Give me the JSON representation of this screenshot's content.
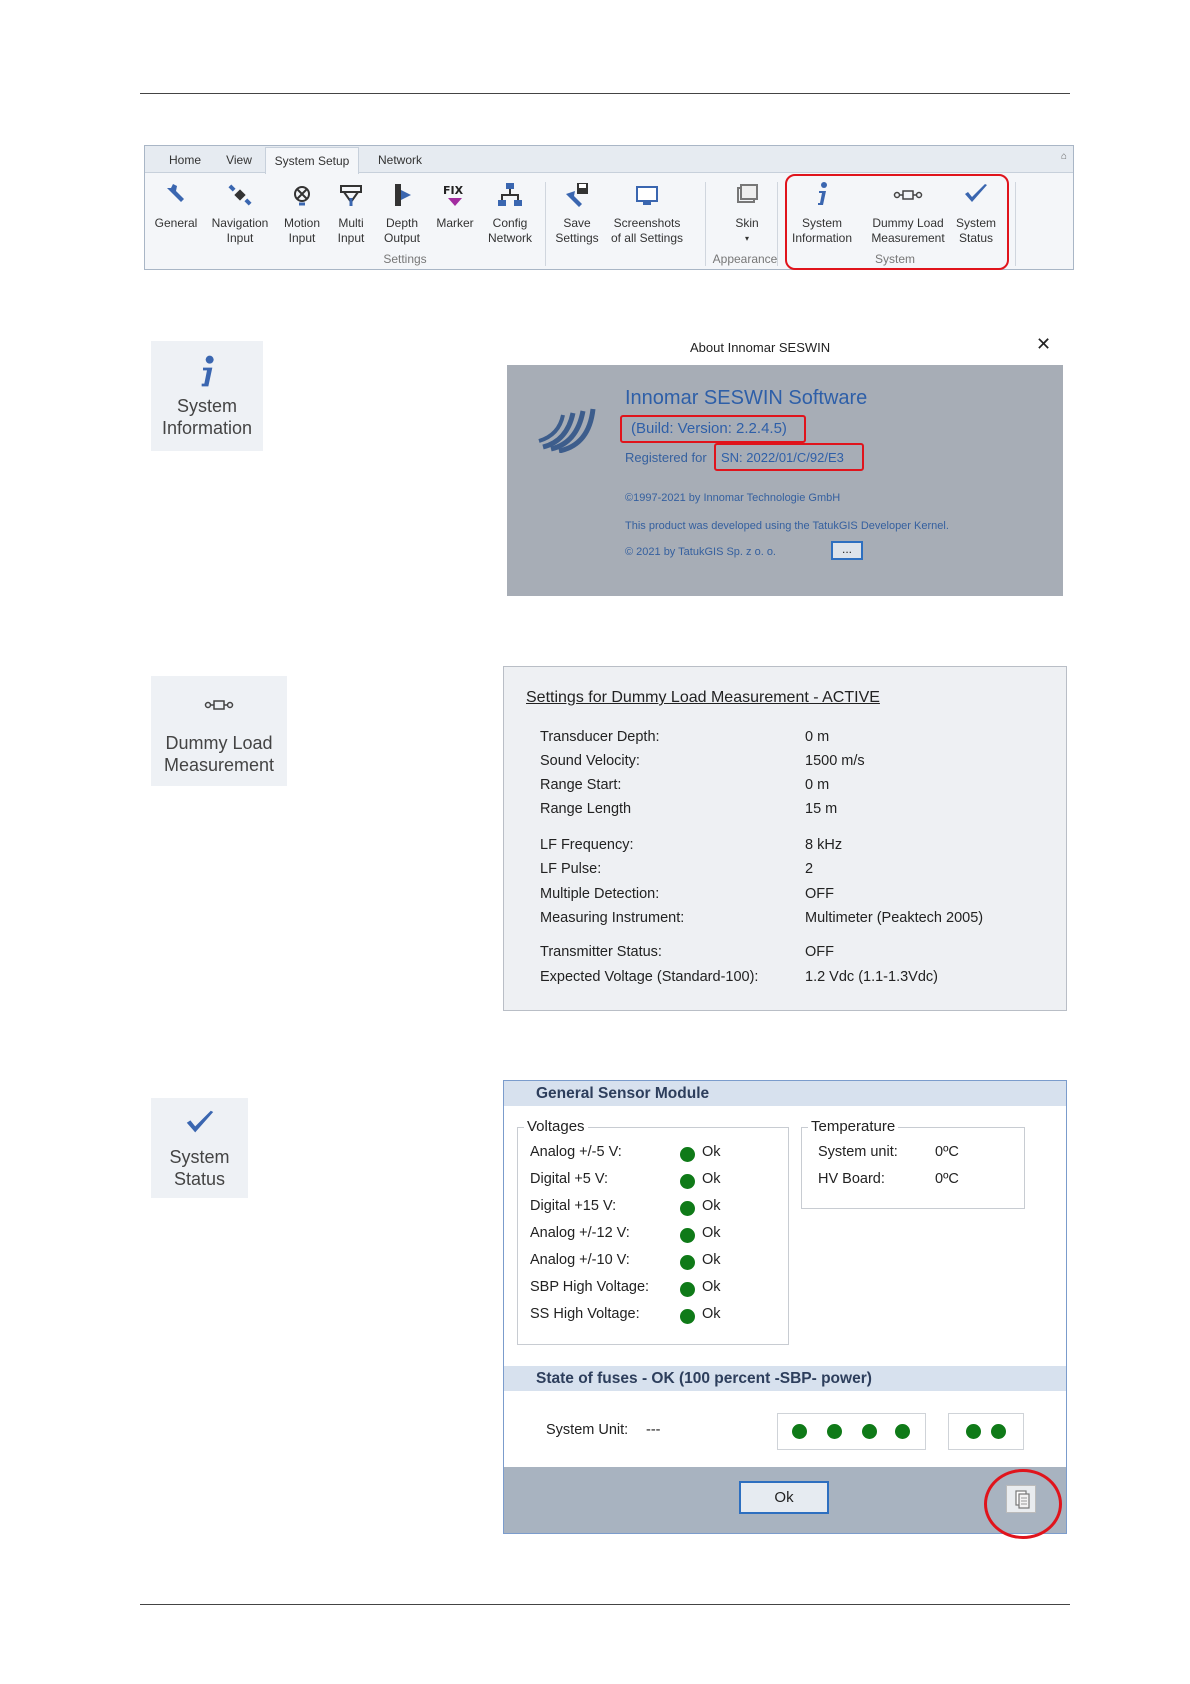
{
  "ribbon": {
    "tabs": [
      "Home",
      "View",
      "System Setup",
      "Network"
    ],
    "buttons": {
      "general": "General",
      "navigation": [
        "Navigation",
        "Input"
      ],
      "motion": [
        "Motion",
        "Input"
      ],
      "multi": [
        "Multi",
        "Input"
      ],
      "depth": [
        "Depth",
        "Output"
      ],
      "marker": "Marker",
      "config": [
        "Config",
        "Network"
      ],
      "save": [
        "Save",
        "Settings"
      ],
      "screenshots": [
        "Screenshots",
        "of all Settings"
      ],
      "skin": "Skin",
      "sysinfo": [
        "System",
        "Information"
      ],
      "dummy": [
        "Dummy Load",
        "Measurement"
      ],
      "status": [
        "System",
        "Status"
      ]
    },
    "groups": {
      "settings": "Settings",
      "appearance": "Appearance",
      "system": "System"
    }
  },
  "big_icons": {
    "sysinfo": [
      "System",
      "Information"
    ],
    "dummy": [
      "Dummy Load",
      "Measurement"
    ],
    "status": [
      "System",
      "Status"
    ]
  },
  "about": {
    "title": "About Innomar SESWIN",
    "product": "Innomar SESWIN Software",
    "build": "(Build: Version: 2.2.4.5)",
    "registered": "Registered for",
    "sn": "SN: 2022/01/C/92/E3",
    "copyright1": "©1997-2021 by Innomar Technologie GmbH",
    "developed": "This product was developed using the TatukGIS Developer Kernel.",
    "copyright2": "© 2021 by TatukGIS Sp. z o. o.",
    "dots_label": "..."
  },
  "dummy": {
    "title": "Settings for Dummy Load Measurement - ACTIVE",
    "rows": [
      {
        "label": "Transducer Depth:",
        "value": "0 m"
      },
      {
        "label": "Sound Velocity:",
        "value": "1500 m/s"
      },
      {
        "label": "Range Start:",
        "value": "0 m"
      },
      {
        "label": "Range Length",
        "value": "15 m"
      },
      {
        "label": "LF Frequency:",
        "value": "8 kHz"
      },
      {
        "label": "LF Pulse:",
        "value": "2"
      },
      {
        "label": "Multiple Detection:",
        "value": "OFF"
      },
      {
        "label": "Measuring Instrument:",
        "value": "Multimeter (Peaktech 2005)"
      },
      {
        "label": "Transmitter Status:",
        "value": "OFF"
      },
      {
        "label": "Expected  Voltage (Standard-100):",
        "value": "1.2 Vdc (1.1-1.3Vdc)"
      }
    ]
  },
  "sensor": {
    "title": "General Sensor Module",
    "voltages_legend": "Voltages",
    "voltages": [
      {
        "label": "Analog +/-5 V:",
        "status": "Ok"
      },
      {
        "label": "Digital +5 V:",
        "status": "Ok"
      },
      {
        "label": "Digital +15 V:",
        "status": "Ok"
      },
      {
        "label": "Analog +/-12 V:",
        "status": "Ok"
      },
      {
        "label": "Analog +/-10 V:",
        "status": "Ok"
      },
      {
        "label": "SBP High Voltage:",
        "status": "Ok"
      },
      {
        "label": "SS High Voltage:",
        "status": "Ok"
      }
    ],
    "temperature_legend": "Temperature",
    "temperature": [
      {
        "label": "System unit:",
        "value": "0ºC"
      },
      {
        "label": "HV Board:",
        "value": "0ºC"
      }
    ],
    "fuses_title": "State of fuses  -  OK (100 percent -SBP- power)",
    "system_unit_label": "System Unit:",
    "system_unit_value": "---",
    "ok_button": "Ok",
    "status_color": "#0f7a18"
  }
}
